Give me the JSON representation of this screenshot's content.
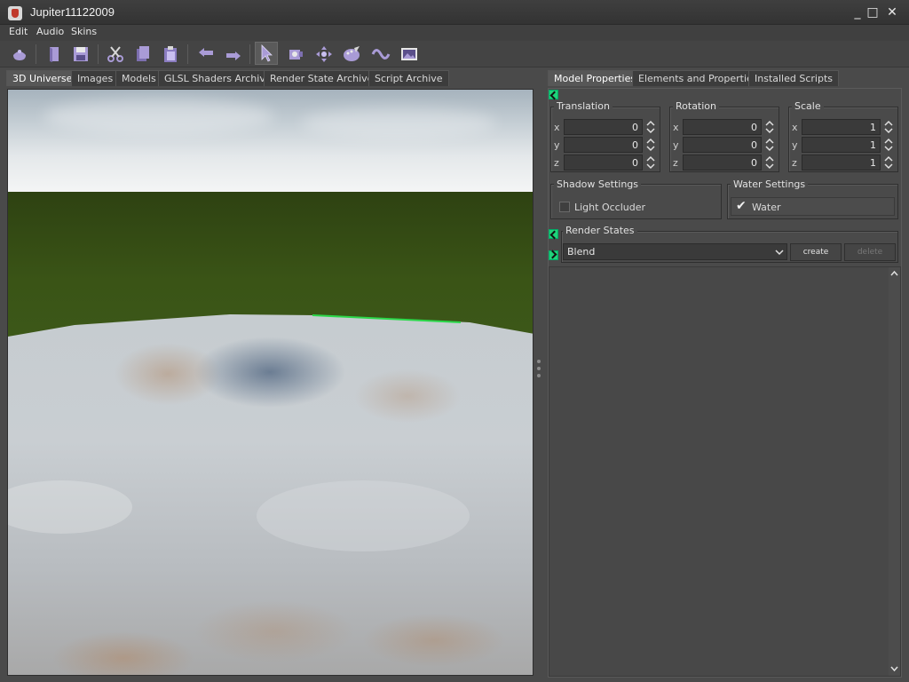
{
  "window": {
    "title": "Jupiter11122009",
    "minimize": "_",
    "maximize": "□",
    "close": "✕"
  },
  "menu": [
    "Edit",
    "Audio",
    "Skins"
  ],
  "toolbar": [
    "potion-icon",
    "open-book-icon",
    "save-disk-icon",
    "scissors-icon",
    "copy-icon",
    "paste-icon",
    "undo-arrow-icon",
    "redo-arrow-icon",
    "pointer-icon",
    "camera-icon",
    "move-arrows-icon",
    "palette-icon",
    "wave-icon",
    "picture-icon"
  ],
  "left_tabs": [
    "3D Universe",
    "Images",
    "Models",
    "GLSL Shaders Archive",
    "Render State Archive",
    "Script Archive"
  ],
  "right_tabs": [
    "Model Properties",
    "Elements and Properties",
    "Installed Scripts"
  ],
  "model_properties": {
    "translation": {
      "title": "Translation",
      "x": "0",
      "y": "0",
      "z": "0"
    },
    "rotation": {
      "title": "Rotation",
      "x": "0",
      "y": "0",
      "z": "0"
    },
    "scale": {
      "title": "Scale",
      "x": "1",
      "y": "1",
      "z": "1"
    },
    "axes": [
      "x",
      "y",
      "z"
    ],
    "shadow": {
      "title": "Shadow Settings",
      "label": "Light Occluder",
      "checked": false
    },
    "water": {
      "title": "Water Settings",
      "label": "Water",
      "checked": true,
      "checkmark": "✔"
    },
    "render_states": {
      "title": "Render States",
      "selected": "Blend",
      "create": "create",
      "delete": "delete"
    }
  },
  "colors": {
    "accent_green": "#1fd27a",
    "icon_purple": "#a99bd6",
    "panel": "#4a4a4a"
  }
}
